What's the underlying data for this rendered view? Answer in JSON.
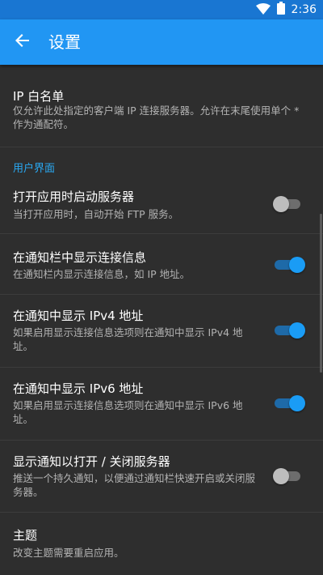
{
  "status_bar": {
    "time": "2:36",
    "icons": [
      "wifi-icon",
      "battery-icon"
    ]
  },
  "app_bar": {
    "title": "设置",
    "back_icon": "arrow-back-icon"
  },
  "prefs": [
    {
      "title": "IP 白名单",
      "summary": "仅允许此处指定的客户端 IP 连接服务器。允许在末尾使用单个 * 作为通配符。"
    }
  ],
  "sections": [
    {
      "header": "用户界面",
      "items": [
        {
          "title": "打开应用时启动服务器",
          "summary": "当打开应用时，自动开始 FTP 服务。",
          "checked": false
        },
        {
          "title": "在通知栏中显示连接信息",
          "summary": "在通知栏内显示连接信息，如 IP 地址。",
          "checked": true
        },
        {
          "title": "在通知中显示 IPv4 地址",
          "summary": "如果启用显示连接信息选项则在通知中显示 IPv4 地址。",
          "checked": true
        },
        {
          "title": "在通知中显示 IPv6 地址",
          "summary": "如果启用显示连接信息选项则在通知中显示 IPv6 地址。",
          "checked": true
        },
        {
          "title": "显示通知以打开 / 关闭服务器",
          "summary": "推送一个持久通知，以便通过通知栏快速开启或关闭服务器。",
          "checked": false
        },
        {
          "title": "主题",
          "summary": "改变主题需要重启应用。"
        }
      ]
    }
  ],
  "colors": {
    "accent": "#2196f3",
    "status_bar": "#1976d2",
    "background": "#2e2e2e",
    "section_header": "#29a9f3"
  }
}
